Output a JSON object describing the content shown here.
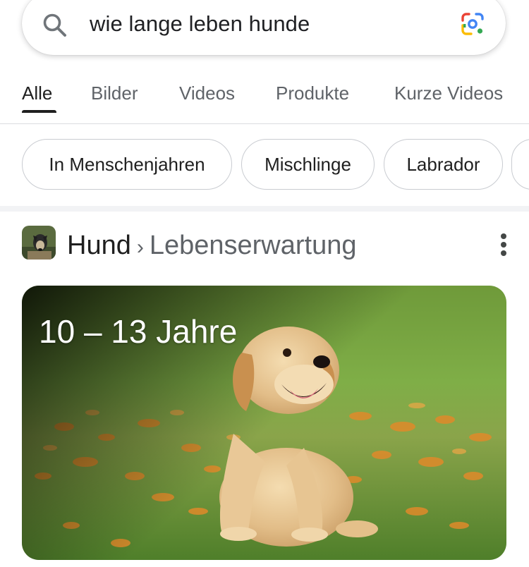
{
  "search": {
    "query": "wie lange leben hunde",
    "icon": "search-icon",
    "lens_icon": "google-lens-icon"
  },
  "tabs": [
    {
      "label": "Alle",
      "active": true
    },
    {
      "label": "Bilder",
      "active": false
    },
    {
      "label": "Videos",
      "active": false
    },
    {
      "label": "Produkte",
      "active": false
    },
    {
      "label": "Kurze Videos",
      "active": false
    }
  ],
  "chips": [
    {
      "label": "In Menschenjahren"
    },
    {
      "label": "Mischlinge"
    },
    {
      "label": "Labrador"
    }
  ],
  "result": {
    "title": "Hund",
    "separator": "›",
    "subtitle": "Lebenserwartung",
    "favicon": "dog-favicon",
    "menu_icon": "more-vert-icon",
    "image_caption": "10 – 13 Jahre",
    "image": "golden-retriever-puppy-image"
  },
  "colors": {
    "text": "#1f1f1f",
    "muted": "#5f6368",
    "border": "#dadce0",
    "chip_border": "#c9ccd1"
  }
}
